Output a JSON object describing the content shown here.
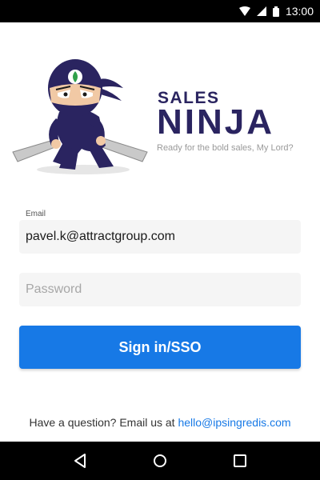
{
  "status": {
    "time": "13:00",
    "icons": [
      "wifi-icon",
      "signal-icon",
      "battery-icon"
    ]
  },
  "brand": {
    "line1": "SALES",
    "line2": "NINJA",
    "tagline": "Ready for the bold sales, My Lord?"
  },
  "form": {
    "email_label": "Email",
    "email_value": "pavel.k@attractgroup.com",
    "password_placeholder": "Password",
    "signin_label": "Sign in/SSO"
  },
  "help": {
    "text": "Have a question? Email us at ",
    "email": "hello@ipsingredis.com"
  },
  "nav": {
    "buttons": [
      "back-icon",
      "home-icon",
      "recents-icon"
    ]
  },
  "colors": {
    "brand_navy": "#2a2460",
    "primary_blue": "#1779e6",
    "field_bg": "#f5f5f5"
  }
}
